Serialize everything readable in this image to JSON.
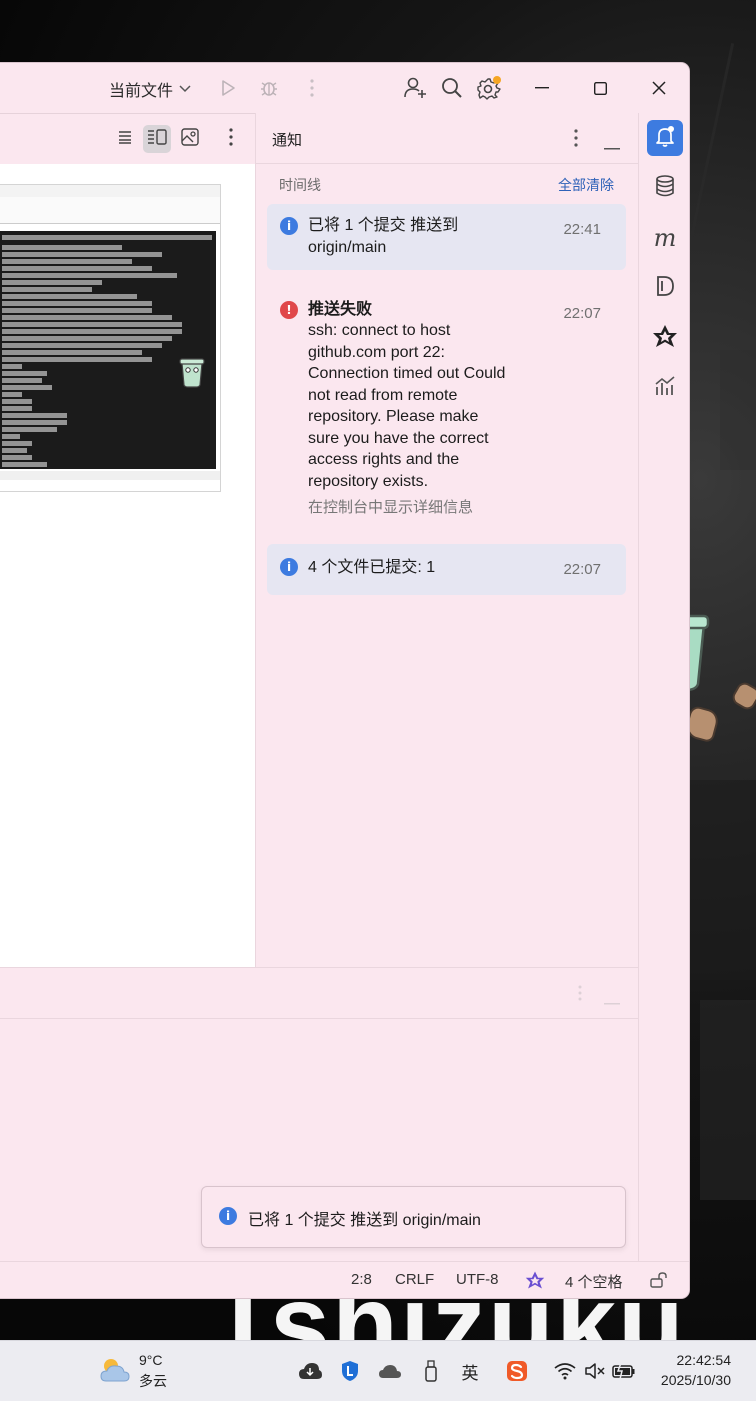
{
  "titlebar": {
    "run_config": "当前文件",
    "icons": [
      "run-icon",
      "debug-icon",
      "more-vertical-icon",
      "add-user-icon",
      "search-icon",
      "settings-icon"
    ],
    "window_buttons": [
      "minimize-icon",
      "maximize-icon",
      "close-icon"
    ]
  },
  "editor": {
    "toolbar_icons": [
      "code-view-icon",
      "split-view-icon",
      "preview-view-icon",
      "more-vertical-icon"
    ]
  },
  "notifications": {
    "title": "通知",
    "timeline_label": "时间线",
    "clear_all": "全部清除",
    "items": [
      {
        "type": "info",
        "message": "已将 1 个提交 推送到 origin/main",
        "time": "22:41"
      },
      {
        "type": "error",
        "title": "推送失败",
        "message": "ssh: connect to host github.com port 22: Connection timed out Could not read from remote repository. Please make sure you have the correct access rights and the repository exists.",
        "detail": "在控制台中显示详细信息",
        "time": "22:07"
      },
      {
        "type": "info",
        "message": "4 个文件已提交: 1",
        "time": "22:07"
      }
    ]
  },
  "tool_strip": {
    "icons": [
      "notifications-bell-icon",
      "database-icon",
      "m-plugin-icon",
      "d-plugin-icon",
      "ai-assistant-icon",
      "profiler-icon"
    ]
  },
  "toast": {
    "message": "已将 1 个提交 推送到 origin/main"
  },
  "statusbar": {
    "position": "2:8",
    "line_ending": "CRLF",
    "encoding": "UTF-8",
    "indent": "4 个空格"
  },
  "taskbar": {
    "temperature": "9°C",
    "condition": "多云",
    "ime": "英",
    "time": "22:42:54",
    "date": "2025/10/30"
  }
}
